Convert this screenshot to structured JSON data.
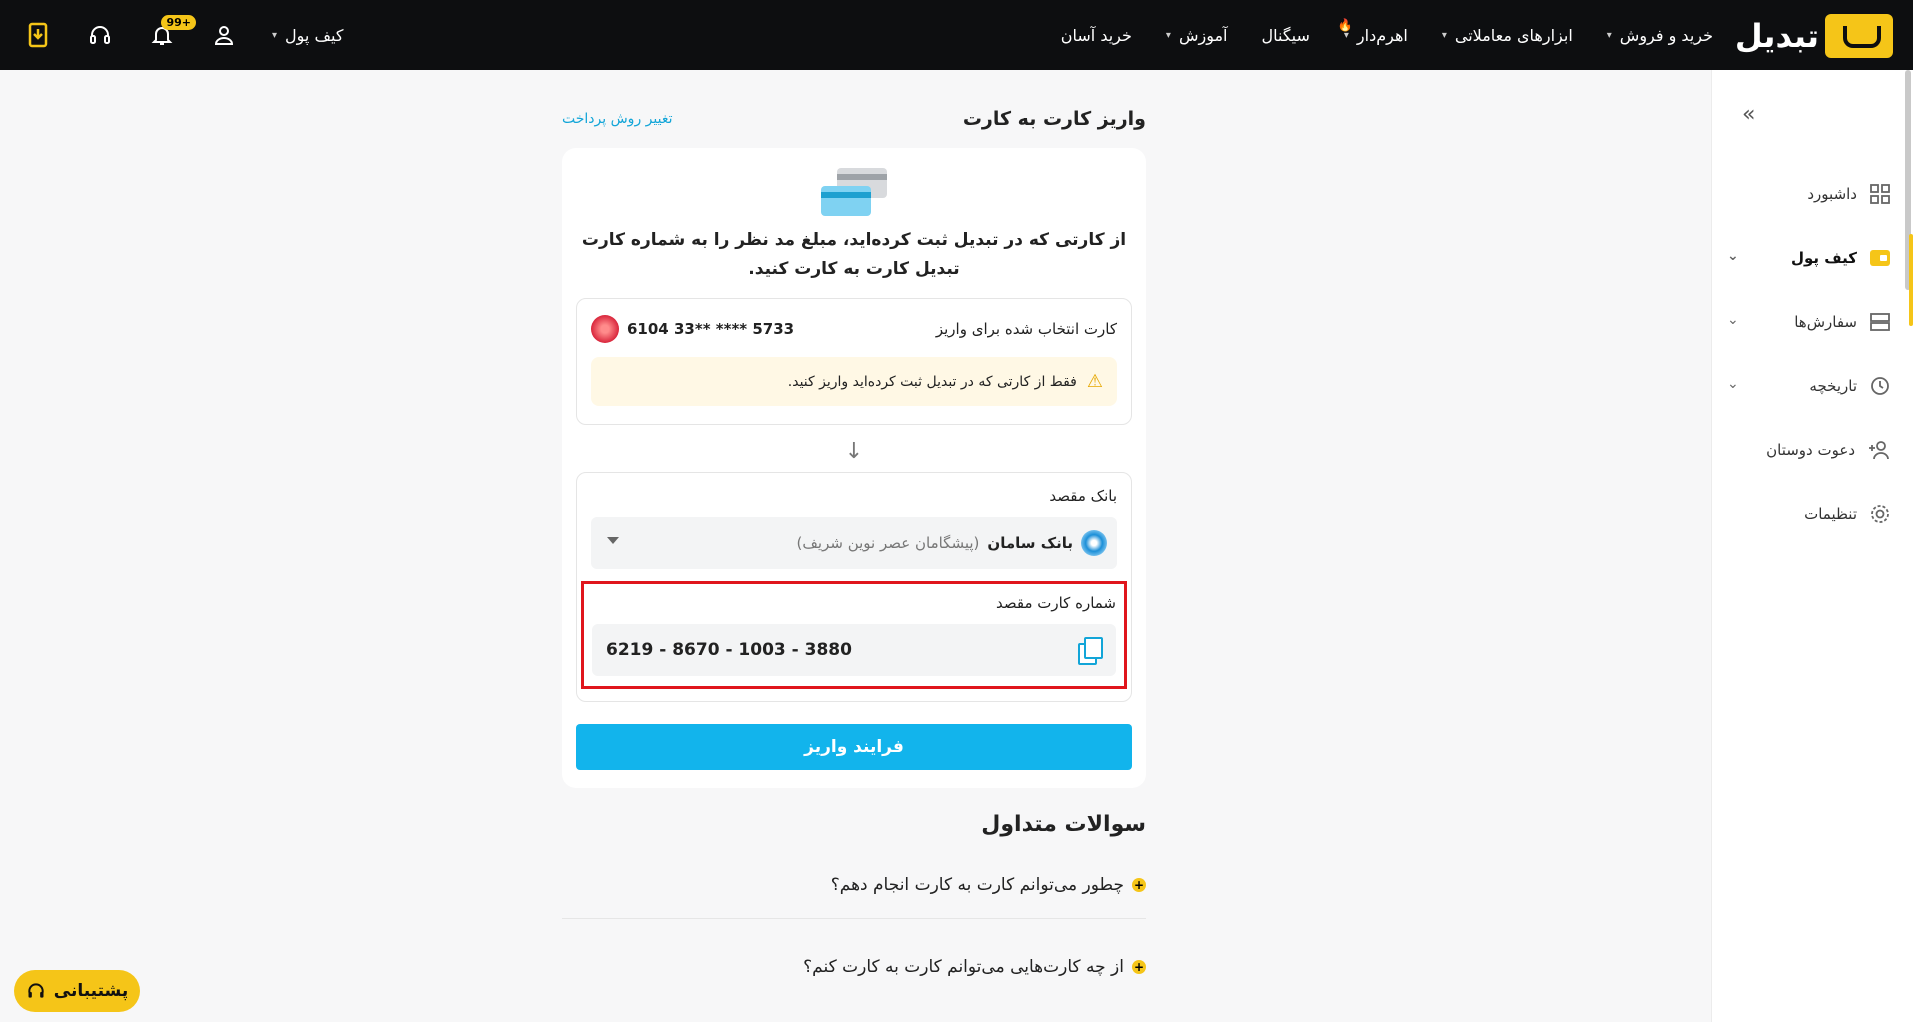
{
  "header": {
    "logo_text": "تبدیل",
    "nav": [
      {
        "label": "خرید و فروش",
        "has_caret": true
      },
      {
        "label": "ابزارهای معاملاتی",
        "has_caret": true
      },
      {
        "label": "اهرم‌دار",
        "has_caret": true
      },
      {
        "label": "سیگنال",
        "has_caret": false
      },
      {
        "label": "آموزش",
        "has_caret": true
      },
      {
        "label": "خرید آسان",
        "has_caret": false
      }
    ],
    "wallet_menu": "کیف پول",
    "notification_badge": "99+",
    "icons": [
      "download-app-icon",
      "headset-icon",
      "bell-icon",
      "user-icon"
    ]
  },
  "sidebar": {
    "items": [
      {
        "label": "داشبورد",
        "icon": "dashboard-icon"
      },
      {
        "label": "کیف پول",
        "icon": "wallet-icon",
        "active": true
      },
      {
        "label": "سفارش‌ها",
        "icon": "orders-icon"
      },
      {
        "label": "تاریخچه",
        "icon": "history-icon"
      },
      {
        "label": "دعوت دوستان",
        "icon": "invite-icon"
      },
      {
        "label": "تنظیمات",
        "icon": "gear-icon"
      }
    ]
  },
  "main": {
    "title": "واریز کارت به کارت",
    "change_method": "تغییر روش پرداخت",
    "intro": "از کارتی که در تبدیل ثبت کرده‌اید، مبلغ مد نظر را به شماره کارت تبدیل کارت به کارت کنید.",
    "source": {
      "label": "کارت انتخاب شده برای واریز",
      "card_masked": "6104 33** **** 5733",
      "warning": "فقط از کارتی که در تبدیل ثبت کرده‌اید واریز کنید."
    },
    "destination": {
      "bank_label": "بانک مقصد",
      "bank_name": "بانک سامان",
      "bank_owner": "(پیشگامان عصر نوین شریف)",
      "card_label": "شماره کارت مقصد",
      "card_number": "6219 - 8670 - 1003 - 3880"
    },
    "submit_label": "فرایند واریز",
    "faq": {
      "title": "سوالات متداول",
      "items": [
        "چطور می‌توانم کارت به کارت انجام دهم؟",
        "از چه کارت‌هایی می‌توانم کارت به کارت کنم؟"
      ]
    }
  },
  "support": {
    "label": "پشتیبانی"
  },
  "colors": {
    "brand": "#f5c518",
    "accent": "#12b4ec",
    "highlight": "#e0161d"
  }
}
